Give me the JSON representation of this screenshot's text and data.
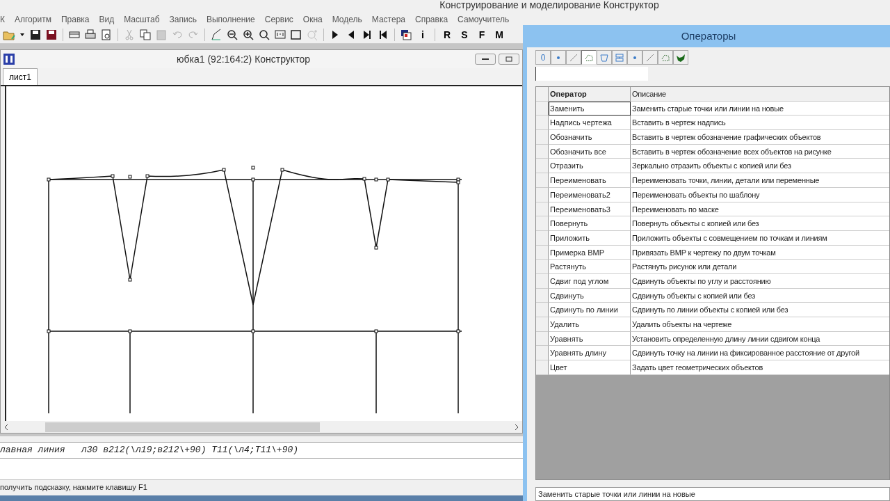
{
  "window": {
    "title": "Конструирование и моделирование  Конструктор"
  },
  "menu": [
    "К",
    "Алгоритм",
    "Правка",
    "Вид",
    "Масштаб",
    "Запись",
    "Выполнение",
    "Сервис",
    "Окна",
    "Модель",
    "Мастера",
    "Справка",
    "Самоучитель"
  ],
  "toolbar_text_buttons": [
    "i",
    "R",
    "S",
    "F",
    "M"
  ],
  "child_window": {
    "title": "юбка1 (92:164:2) Конструктор",
    "tabs": [
      {
        "label": "лист1",
        "selected": true
      }
    ]
  },
  "command_line": "лавная линия   л30 в212(\\л19;в212\\+90) Т11(\\л4;Т11\\+90)",
  "status_bar": "получить подсказку, нажмите клавишу F1",
  "operators": {
    "title": "Операторы",
    "tools": [
      {
        "kind": "text",
        "label": "0",
        "selected": false
      },
      {
        "kind": "dot",
        "selected": false
      },
      {
        "kind": "line",
        "selected": false
      },
      {
        "kind": "polygon",
        "selected": true
      },
      {
        "kind": "cup",
        "selected": false
      },
      {
        "kind": "stack",
        "selected": false
      },
      {
        "kind": "dot",
        "selected": false
      },
      {
        "kind": "line",
        "selected": false
      },
      {
        "kind": "polygon",
        "selected": false
      },
      {
        "kind": "blob",
        "selected": false
      }
    ],
    "columns": [
      "Оператор",
      "Описание"
    ],
    "rows": [
      {
        "name": "Заменить",
        "description": "Заменить старые точки или линии на новые",
        "selected": true
      },
      {
        "name": "Надпись чертежа",
        "description": "Вставить в чертеж надпись",
        "selected": false
      },
      {
        "name": "Обозначить",
        "description": "Вставить в чертеж обозначение графических объектов",
        "selected": false
      },
      {
        "name": "Обозначить все",
        "description": "Вставить в чертеж обозначение всех объектов на рисунке",
        "selected": false
      },
      {
        "name": "Отразить",
        "description": "Зеркально отразить объекты с копией или без",
        "selected": false
      },
      {
        "name": "Переименовать",
        "description": "Переименовать точки, линии, детали или переменные",
        "selected": false
      },
      {
        "name": "Переименовать2",
        "description": "Переименовать объекты по шаблону",
        "selected": false
      },
      {
        "name": "Переименовать3",
        "description": "Переименовать по маске",
        "selected": false
      },
      {
        "name": "Повернуть",
        "description": "Повернуть объекты с копией или без",
        "selected": false
      },
      {
        "name": "Приложить",
        "description": "Приложить объекты с совмещением по точкам и линиям",
        "selected": false
      },
      {
        "name": "Примерка BMP",
        "description": "Привязать BMP к чертежу по двум точкам",
        "selected": false
      },
      {
        "name": "Растянуть",
        "description": "Растянуть рисунок или детали",
        "selected": false
      },
      {
        "name": "Сдвиг под углом",
        "description": "Сдвинуть объекты по углу и расстоянию",
        "selected": false
      },
      {
        "name": "Сдвинуть",
        "description": "Сдвинуть объекты с копией или без",
        "selected": false
      },
      {
        "name": "Сдвинуть по линии",
        "description": "Сдвинуть по линии объекты с копией или без",
        "selected": false
      },
      {
        "name": "Удалить",
        "description": "Удалить объекты на чертеже",
        "selected": false
      },
      {
        "name": "Уравнять",
        "description": "Установить определенную длину линии сдвигом конца",
        "selected": false
      },
      {
        "name": "Уравнять длину",
        "description": "Сдвинуть точку на линии на фиксированное расстояние от другой",
        "selected": false
      },
      {
        "name": "Цвет",
        "description": "Задать цвет геометрических объектов",
        "selected": false
      }
    ],
    "status": "Заменить старые точки или линии на новые"
  }
}
